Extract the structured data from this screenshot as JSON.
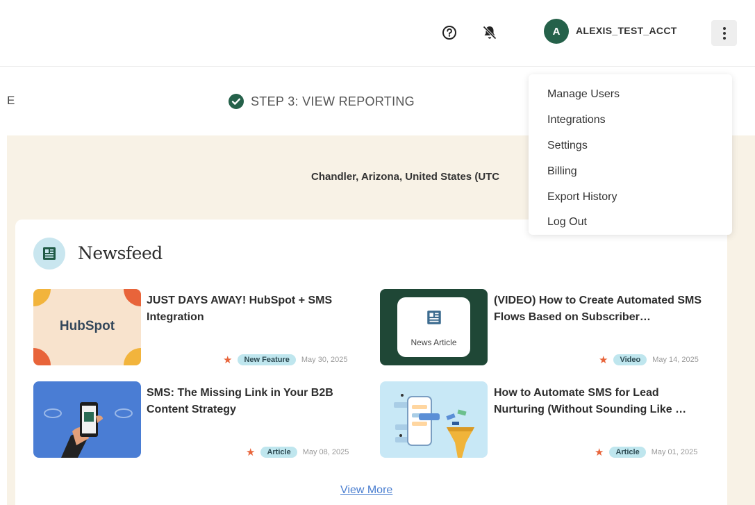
{
  "header": {
    "account_initial": "A",
    "account_name": "ALEXIS_TEST_ACCT"
  },
  "icons": [
    "help-icon",
    "bell-off-icon",
    "more-vertical-icon",
    "check-circle-icon",
    "newspaper-icon",
    "star-icon"
  ],
  "steps": {
    "previous_cut": "E",
    "current": "STEP 3: VIEW REPORTING"
  },
  "location": "Chandler, Arizona, United States (UTC",
  "menu": {
    "items": [
      "Manage Users",
      "Integrations",
      "Settings",
      "Billing",
      "Export History",
      "Log Out"
    ]
  },
  "newsfeed": {
    "title": "Newsfeed",
    "items": [
      {
        "title": "JUST DAYS AWAY! HubSpot + SMS Integration",
        "tag": "New Feature",
        "date": "May 30, 2025",
        "thumb_text": "HubSpot"
      },
      {
        "title": "(VIDEO) How to Create Automated SMS Flows Based on Subscriber…",
        "tag": "Video",
        "date": "May 14, 2025",
        "thumb_text": "News Article"
      },
      {
        "title": "SMS: The Missing Link in Your B2B Content Strategy",
        "tag": "Article",
        "date": "May 08, 2025"
      },
      {
        "title": "How to Automate SMS for Lead Nurturing (Without Sounding Like …",
        "tag": "Article",
        "date": "May 01, 2025"
      }
    ],
    "view_more": "View More"
  },
  "colors": {
    "accent_green": "#25614a",
    "beige_bg": "#f8f2e6",
    "badge_bg": "#bfe6ee",
    "star": "#e8643a",
    "link": "#4a7ed0"
  }
}
